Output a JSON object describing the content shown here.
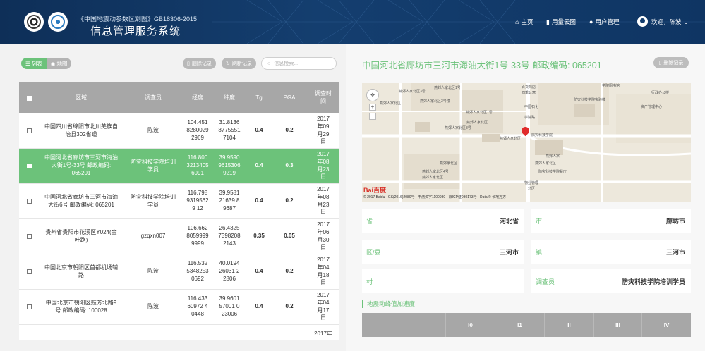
{
  "header": {
    "subtitle": "《中国地震动参数区划图》GB18306-2015",
    "title": "信息管理服务系统",
    "nav": [
      {
        "icon": "home-icon",
        "glyph": "⌂",
        "label": "主页"
      },
      {
        "icon": "chart-icon",
        "glyph": "▮",
        "label": "用量云图"
      },
      {
        "icon": "user-icon",
        "glyph": "●",
        "label": "用户管理"
      }
    ],
    "welcome": "欢迎，陈波",
    "dropdown": "⌄"
  },
  "toolbar": {
    "list_tab": "列表",
    "map_tab": "地图",
    "delete_btn": "删除记录",
    "refresh_btn": "刷新记录",
    "search_placeholder": "信息检索..."
  },
  "table": {
    "headers": {
      "region": "区域",
      "investigator": "调查员",
      "lon": "经度",
      "lat": "纬度",
      "tg": "Tg",
      "pga": "PGA",
      "date": "调查时间"
    },
    "rows": [
      {
        "region": "中国四川省绵阳市北川羌族自治县302省道",
        "investigator": "陈波",
        "lon": "104.45182800292969",
        "lat": "31.813687755517104",
        "tg": "0.4",
        "pga": "0.2",
        "date": "2017年09月29日",
        "selected": false
      },
      {
        "region": "中国河北省廊坊市三河市海油大街1号-33号 邮政编码: 065201",
        "investigator": "防灾科技学院培训学员",
        "lon": "116.80032134056091",
        "lat": "39.959096153069219",
        "tg": "0.4",
        "pga": "0.3",
        "date": "2017年08月23日",
        "selected": true
      },
      {
        "region": "中国河北省廊坊市三河市海油大街6号 邮政编码: 065201",
        "investigator": "防灾科技学院培训学员",
        "lon": "116.79893195629 12",
        "lat": "39.958121639 89687",
        "tg": "0.4",
        "pga": "0.2",
        "date": "2017年08月23日",
        "selected": false
      },
      {
        "region": "贵州省贵阳市花溪区Y024(金叶路)",
        "investigator": "gzqxn007",
        "lon": "106.66280599999999",
        "lat": "26.432573982082143",
        "tg": "0.35",
        "pga": "0.05",
        "date": "2017年06月30日",
        "selected": false
      },
      {
        "region": "中国北京市朝阳区首都机场辅路",
        "investigator": "陈波",
        "lon": "116.53253482530692",
        "lat": "40.019426031 22806",
        "tg": "0.4",
        "pga": "0.2",
        "date": "2017年04月18日",
        "selected": false
      },
      {
        "region": "中国北京市朝阳区鼓芳北路9号 邮政编码: 100028",
        "investigator": "陈波",
        "lon": "116.43360972 40448",
        "lat": "39.960157001 023006",
        "tg": "0.4",
        "pga": "0.2",
        "date": "2017年04月17日",
        "selected": false
      }
    ],
    "partial_row_date": "2017年"
  },
  "detail": {
    "address": "中国河北省廊坊市三河市海油大街1号-33号 邮政编码: 065201",
    "delete_btn": "删除记录",
    "map": {
      "baidu_a": "Bai",
      "baidu_b": "百度",
      "copyright": "© 2017 Baidu - GS(2016)2089号 - 甲测资字1100930 - 京ICP证030173号 - Data © 长地万方",
      "pois": [
        "燕郊人家北区3号",
        "燕郊人家北区1号",
        "燕郊人家北区",
        "燕郊人家北区3号楼",
        "百货商店",
        "四季公寓",
        "燕郊人家北区1号",
        "燕郊人家北区8号",
        "燕郊人家北区",
        "中国石化",
        "学院路",
        "资产管理中心",
        "燕郊人家北区",
        "防灾科技学院",
        "学院图书馆",
        "行政办公楼",
        "燕郊人家北区",
        "燕郊人家北区4号",
        "燕郊人家北区",
        "防灾科技学院餐厅",
        "燕郊人家",
        "物业管理",
        "北区",
        "燕郊家北区",
        "防灾科技学院实验楼"
      ]
    },
    "fields": [
      {
        "label": "省",
        "value": "河北省"
      },
      {
        "label": "市",
        "value": "廊坊市"
      },
      {
        "label": "区/县",
        "value": "三河市"
      },
      {
        "label": "镇",
        "value": "三河市"
      },
      {
        "label": "村",
        "value": ""
      },
      {
        "label": "调查员",
        "value": "防灾科技学院培训学员"
      }
    ],
    "section_title": "地震动峰值加速度",
    "intensity_headers": [
      "",
      "I0",
      "I1",
      "II",
      "III",
      "IV"
    ]
  }
}
